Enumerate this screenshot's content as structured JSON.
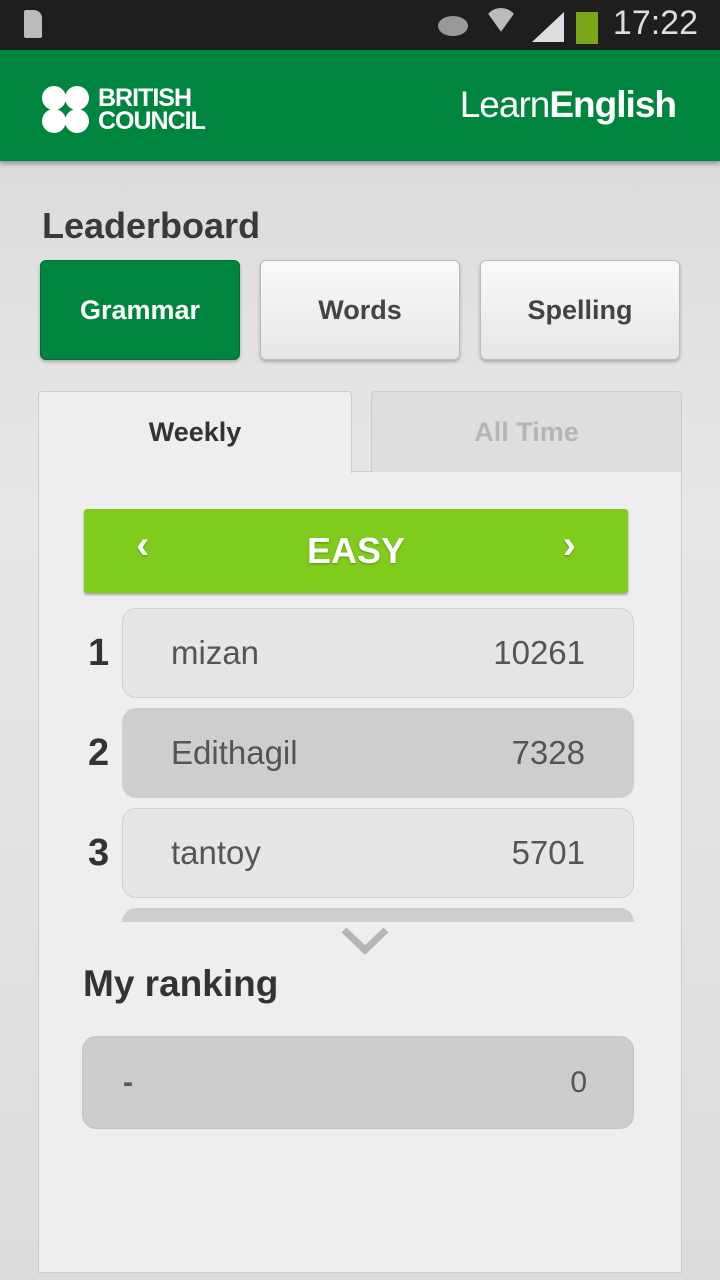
{
  "status_bar": {
    "time": "17:22",
    "icons": [
      "sim-missing-icon",
      "eye-icon",
      "wifi-icon",
      "signal-icon",
      "battery-icon"
    ]
  },
  "header": {
    "brand": "BRITISH COUNCIL",
    "brand_line1": "BRITISH",
    "brand_line2": "COUNCIL",
    "app_light": "Learn",
    "app_bold": "English"
  },
  "page": {
    "title": "Leaderboard"
  },
  "categories": [
    {
      "label": "Grammar",
      "active": true
    },
    {
      "label": "Words",
      "active": false
    },
    {
      "label": "Spelling",
      "active": false
    }
  ],
  "tabs": [
    {
      "label": "Weekly",
      "active": true
    },
    {
      "label": "All Time",
      "active": false
    }
  ],
  "level": {
    "label": "EASY"
  },
  "leaders": [
    {
      "rank": "1",
      "name": "mizan",
      "score": "10261"
    },
    {
      "rank": "2",
      "name": "Edithagil",
      "score": "7328"
    },
    {
      "rank": "3",
      "name": "tantoy",
      "score": "5701"
    }
  ],
  "my_ranking": {
    "title": "My ranking",
    "rank": "-",
    "score": "0"
  },
  "colors": {
    "brand": "#00853f",
    "level": "#80cc1c"
  }
}
